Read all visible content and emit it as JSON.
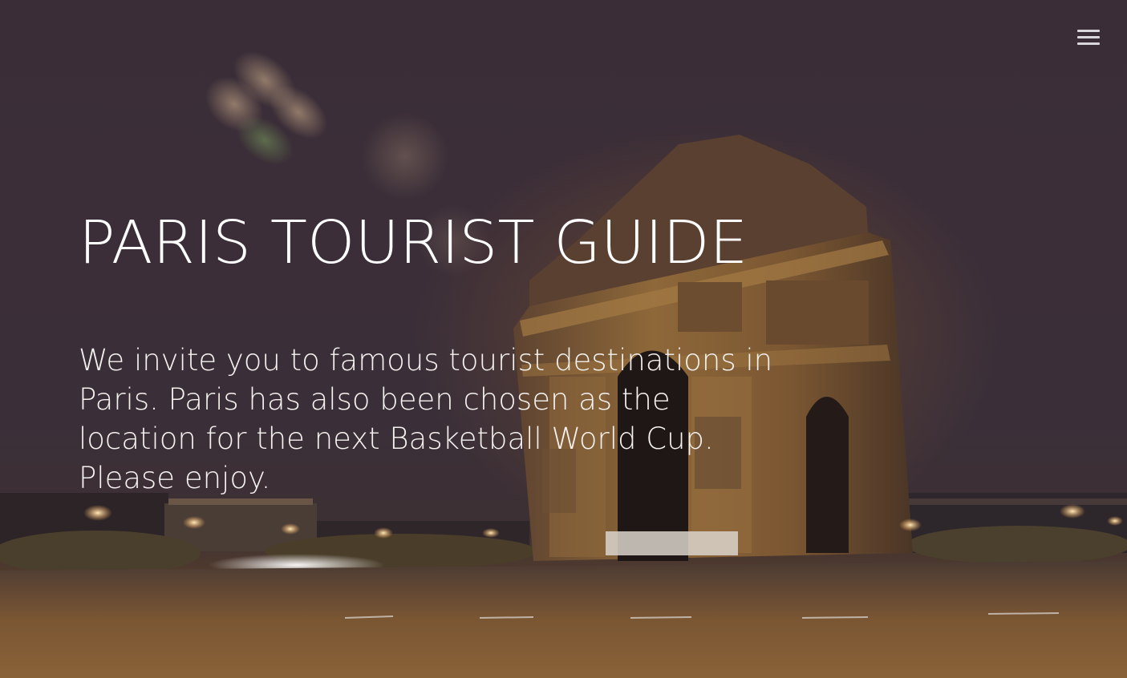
{
  "menu": {
    "icon": "hamburger-menu-icon"
  },
  "hero": {
    "title": "PARIS TOURIST GUIDE",
    "intro": "We invite you to famous tourist destinations in Paris. Paris has also been chosen as the location for the next Basketball World Cup. Please enjoy.",
    "background": "arc-de-triomphe-night-photo"
  },
  "colors": {
    "text": "#ffffff",
    "sky": "#3a2d37",
    "stone_lit": "#8a6236",
    "pavement": "#6b4c2e"
  }
}
